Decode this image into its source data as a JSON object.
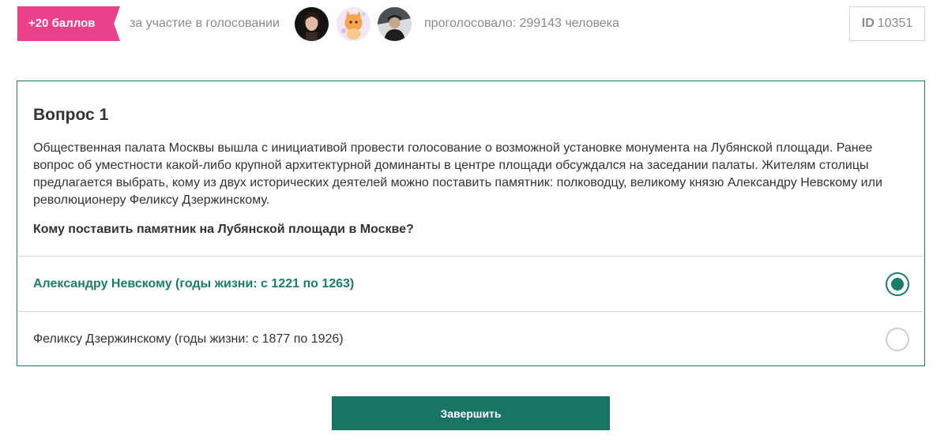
{
  "header": {
    "points_badge": "+20 баллов",
    "points_caption": "за участие в голосовании",
    "voters_text": "проголосовало: 299143 человека",
    "id_label": "ID",
    "id_value": "10351",
    "avatars": [
      "avatar-girl",
      "avatar-cat-cartoon",
      "avatar-man-winter"
    ]
  },
  "question": {
    "title": "Вопрос 1",
    "description": "Общественная палата Москвы вышла с инициативой провести голосование о возможной установке монумента на Лубянской площади. Ранее вопрос об уместности какой-либо крупной архитектурной доминанты в центре площади обсуждался на заседании палаты. Жителям столицы предлагается выбрать, кому из двух исторических деятелей можно поставить памятник: полководцу, великому князю Александру Невскому или революционеру Феликсу Дзержинскому.",
    "prompt": "Кому поставить памятник на Лубянской площади в Москве?",
    "options": [
      {
        "label": "Александру Невскому (годы жизни: с 1221 по 1263)",
        "selected": true
      },
      {
        "label": "Феликсу Дзержинскому (годы жизни: с 1877 по 1926)",
        "selected": false
      }
    ]
  },
  "actions": {
    "finish_label": "Завершить"
  },
  "colors": {
    "accent": "#1a7d6c",
    "badge": "#e9418a",
    "muted_text": "#8a8a8a"
  }
}
